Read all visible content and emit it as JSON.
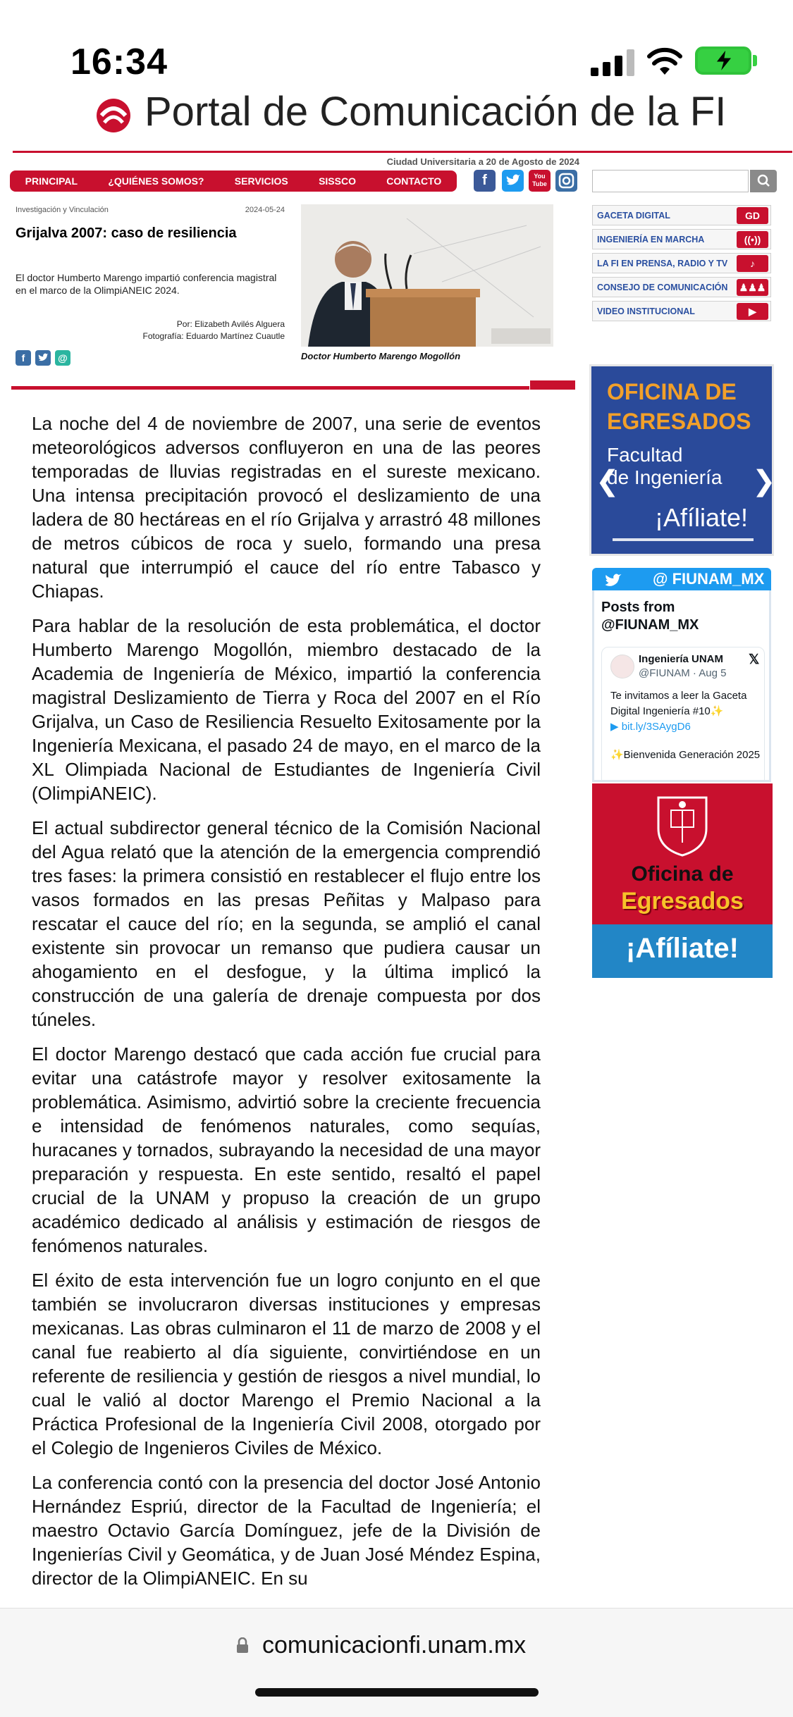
{
  "status_bar": {
    "time": "16:34"
  },
  "site": {
    "title": "Portal de Comunicación de la FI",
    "dateline": "Ciudad Universitaria a 20 de Agosto de 2024"
  },
  "nav": {
    "items": [
      "PRINCIPAL",
      "¿QUIÉNES SOMOS?",
      "SERVICIOS",
      "SISSCO",
      "CONTACTO"
    ]
  },
  "social": {
    "facebook": "f",
    "twitter": "t",
    "youtube": "You Tube",
    "instagram": "instagram"
  },
  "article": {
    "section": "Investigación y Vinculación",
    "date": "2024-05-24",
    "headline": "Grijalva 2007: caso de resiliencia",
    "lead": "El doctor Humberto Marengo impartió conferencia magistral en el marco de la OlimpiANEIC 2024.",
    "author": "Por: Elizabeth Avilés Alguera",
    "photo_credit": "Fotografía: Eduardo Martínez Cuautle",
    "caption": "Doctor Humberto Marengo Mogollón",
    "paragraphs": [
      "La noche del 4 de noviembre de 2007, una serie de eventos meteorológicos adversos confluyeron en una de las peores temporadas de lluvias registradas en el sureste mexicano. Una intensa precipitación provocó el deslizamiento de una ladera de 80 hectáreas en el río Grijalva y arrastró 48 millones de metros cúbicos de roca y suelo, formando una presa natural que interrumpió el cauce del río entre Tabasco y Chiapas.",
      "Para hablar de la resolución de esta problemática, el doctor Humberto Marengo Mogollón, miembro destacado de la Academia de Ingeniería de México, impartió la conferencia magistral Deslizamiento de Tierra y Roca del 2007 en el Río Grijalva, un Caso de Resiliencia Resuelto Exitosamente por la Ingeniería Mexicana, el pasado 24 de mayo, en el marco de la XL Olimpiada Nacional de Estudiantes de Ingeniería Civil (OlimpiANEIC).",
      "El actual subdirector general técnico de la Comisión Nacional del Agua relató que la atención de la emergencia comprendió tres fases: la primera consistió en restablecer el flujo entre los vasos formados en las presas Peñitas y Malpaso para rescatar el cauce del río; en la segunda, se amplió el canal existente sin provocar un remanso que pudiera causar un ahogamiento en el desfogue, y la última implicó la construcción de una galería de drenaje compuesta por dos túneles.",
      "El doctor Marengo destacó que cada acción fue crucial para evitar una catástrofe mayor y resolver exitosamente la problemática. Asimismo, advirtió sobre la creciente frecuencia e intensidad de fenómenos naturales, como sequías, huracanes y tornados, subrayando la necesidad de una mayor preparación y respuesta. En este sentido, resaltó el papel crucial de la UNAM y propuso la creación de un grupo académico dedicado al análisis y estimación de riesgos de fenómenos naturales.",
      "El éxito de esta intervención fue un logro conjunto en el que también se involucraron diversas instituciones y empresas mexicanas. Las obras culminaron el 11 de marzo de 2008 y el canal fue reabierto al día siguiente, convirtiéndose en un referente de resiliencia y gestión de riesgos a nivel mundial, lo cual le valió al doctor Marengo el Premio Nacional a la Práctica Profesional de la Ingeniería Civil 2008, otorgado por el Colegio de Ingenieros Civiles de México.",
      "La conferencia contó con la presencia del doctor José Antonio Hernández Espriú, director de la Facultad de Ingeniería; el maestro Octavio García Domínguez, jefe de la División de Ingenierías Civil y Geomática, y de Juan José Méndez Espina, director de la OlimpiANEIC. En su"
    ]
  },
  "sidebar": {
    "links": [
      {
        "label": "GACETA DIGITAL",
        "icon": "GD"
      },
      {
        "label": "INGENIERÍA EN MARCHA",
        "icon": "((•))"
      },
      {
        "label": "LA FI EN PRENSA, RADIO Y TV",
        "icon": "♪"
      },
      {
        "label": "CONSEJO DE COMUNICACIÓN",
        "icon": "♟♟♟"
      },
      {
        "label": "VIDEO INSTITUCIONAL",
        "icon": "▶"
      }
    ],
    "banner_egresados": {
      "line1": "OFICINA DE",
      "line2": "EGRESADOS",
      "line3": "Facultad",
      "line4": "de Ingeniería",
      "cta": "¡Afíliate!"
    },
    "twitter": {
      "handle": "@ FIUNAM_MX",
      "posts_from": "Posts from @FIUNAM_MX",
      "account_name": "Ingeniería UNAM",
      "account_meta": "@FIUNAM · Aug 5",
      "tweet_text": "Te invitamos a leer la Gaceta Digital Ingeniería #10✨",
      "tweet_link": "bit.ly/3SAygD6",
      "tweet_text2": "✨Bienvenida Generación 2025"
    },
    "banner_afiliate": {
      "line1": "Oficina de",
      "line2": "Egresados",
      "cta": "¡Afíliate!"
    }
  },
  "browser": {
    "url": "comunicacionfi.unam.mx"
  },
  "colors": {
    "brand_red": "#c8102e",
    "banner_blue": "#2a4a9a",
    "twitter_blue": "#1d9bf0"
  }
}
